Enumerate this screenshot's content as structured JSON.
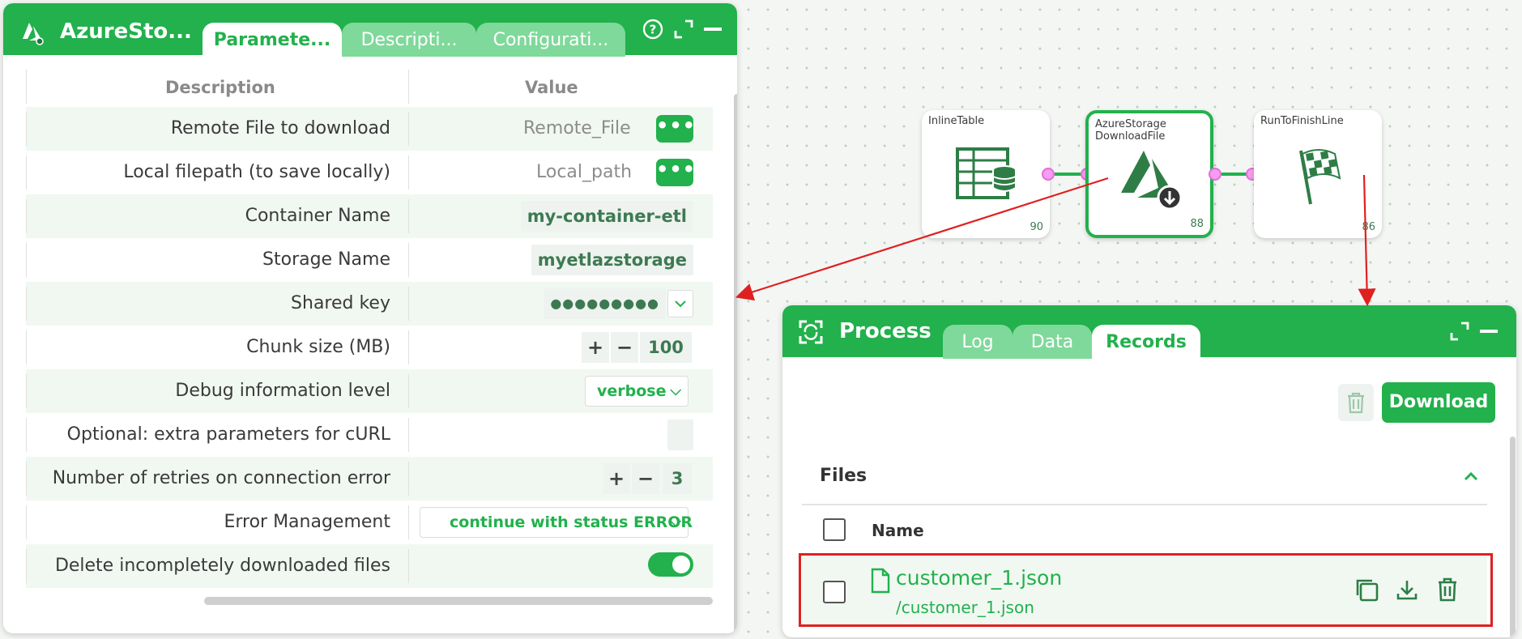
{
  "param_panel": {
    "title": "AzureSto...",
    "tabs": [
      {
        "label": "Paramete...",
        "active": true
      },
      {
        "label": "Descripti...",
        "active": false
      },
      {
        "label": "Configurati...",
        "active": false
      }
    ],
    "icons": [
      "help-icon",
      "expand-icon",
      "minimize-icon"
    ],
    "columns": {
      "description": "Description",
      "value": "Value"
    },
    "rows": {
      "remote_file": {
        "label": "Remote File to download",
        "value": "Remote_File",
        "button": "•••"
      },
      "local_path": {
        "label": "Local filepath (to save locally)",
        "value": "Local_path",
        "button": "•••"
      },
      "container": {
        "label": "Container Name",
        "value": "my-container-etl"
      },
      "storage": {
        "label": "Storage Name",
        "value": "myetlazstorage"
      },
      "shared_key": {
        "label": "Shared key",
        "value": "●●●●●●●●●"
      },
      "chunk": {
        "label": "Chunk size (MB)",
        "value": "100",
        "plus": "+",
        "minus": "−"
      },
      "debug": {
        "label": "Debug information level",
        "value": "verbose"
      },
      "curl": {
        "label": "Optional: extra parameters for cURL",
        "value": ""
      },
      "retries": {
        "label": "Number of retries on connection error",
        "value": "3",
        "plus": "+",
        "minus": "−"
      },
      "error_mgmt": {
        "label": "Error Management",
        "value": "continue with status ERROR"
      },
      "delete_incomplete": {
        "label": "Delete incompletely downloaded files",
        "value": true
      }
    }
  },
  "flow": {
    "nodes": [
      {
        "label": "InlineTable",
        "count": "90",
        "icon": "table-database-icon"
      },
      {
        "label": "AzureStorage DownloadFile",
        "count": "88",
        "icon": "azure-download-icon",
        "selected": true
      },
      {
        "label": "RunToFinishLine",
        "count": "86",
        "icon": "checkered-flag-icon"
      }
    ]
  },
  "process_panel": {
    "title": "Process",
    "tabs": [
      {
        "label": "Log",
        "active": false
      },
      {
        "label": "Data",
        "active": false
      },
      {
        "label": "Records",
        "active": true
      }
    ],
    "download_label": "Download",
    "files_title": "Files",
    "name_header": "Name",
    "files": [
      {
        "name": "customer_1.json",
        "path": "/customer_1.json"
      }
    ]
  },
  "colors": {
    "accent": "#22b14c",
    "annotation": "#e02020"
  }
}
